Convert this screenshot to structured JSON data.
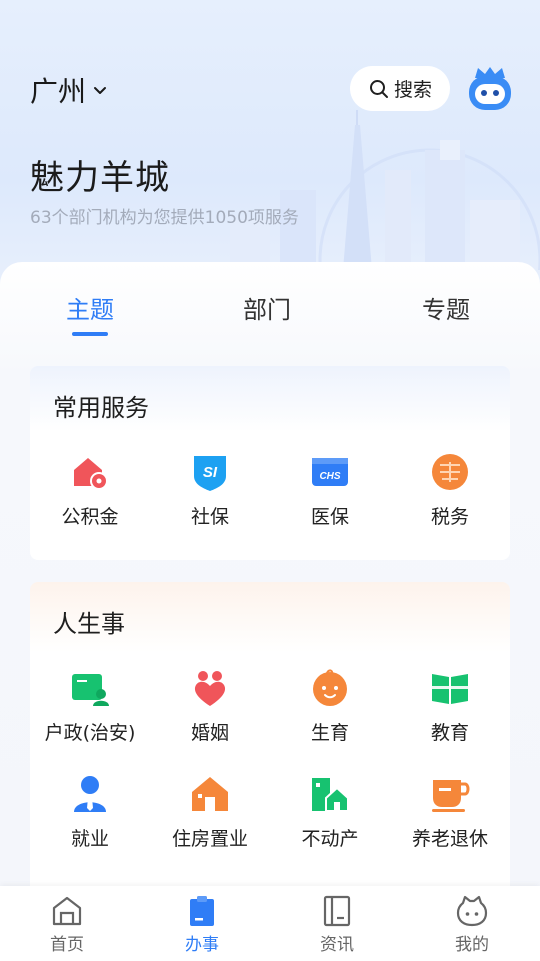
{
  "header": {
    "city": "广州",
    "search_label": "搜索",
    "title": "魅力羊城",
    "subtitle": "63个部门机构为您提供1050项服务"
  },
  "tabs": [
    {
      "label": "主题",
      "active": true
    },
    {
      "label": "部门",
      "active": false
    },
    {
      "label": "专题",
      "active": false
    }
  ],
  "common_services": {
    "title": "常用服务",
    "items": [
      {
        "label": "公积金",
        "icon": "housing-fund-icon"
      },
      {
        "label": "社保",
        "icon": "social-security-icon"
      },
      {
        "label": "医保",
        "icon": "medical-insurance-icon"
      },
      {
        "label": "税务",
        "icon": "tax-icon"
      }
    ]
  },
  "life_events": {
    "title": "人生事",
    "items": [
      {
        "label": "户政(治安)",
        "icon": "household-icon"
      },
      {
        "label": "婚姻",
        "icon": "marriage-icon"
      },
      {
        "label": "生育",
        "icon": "birth-icon"
      },
      {
        "label": "教育",
        "icon": "education-icon"
      },
      {
        "label": "就业",
        "icon": "employment-icon"
      },
      {
        "label": "住房置业",
        "icon": "housing-icon"
      },
      {
        "label": "不动产",
        "icon": "real-estate-icon"
      },
      {
        "label": "养老退休",
        "icon": "retirement-icon"
      }
    ]
  },
  "bottom_nav": [
    {
      "label": "首页",
      "icon": "home-icon",
      "active": false
    },
    {
      "label": "办事",
      "icon": "affairs-icon",
      "active": true
    },
    {
      "label": "资讯",
      "icon": "news-icon",
      "active": false
    },
    {
      "label": "我的",
      "icon": "profile-icon",
      "active": false
    }
  ],
  "colors": {
    "accent": "#2f7df6",
    "hero_bg": "#dde9fc",
    "red": "#f0555a",
    "orange": "#f5873a",
    "green": "#17c270"
  }
}
